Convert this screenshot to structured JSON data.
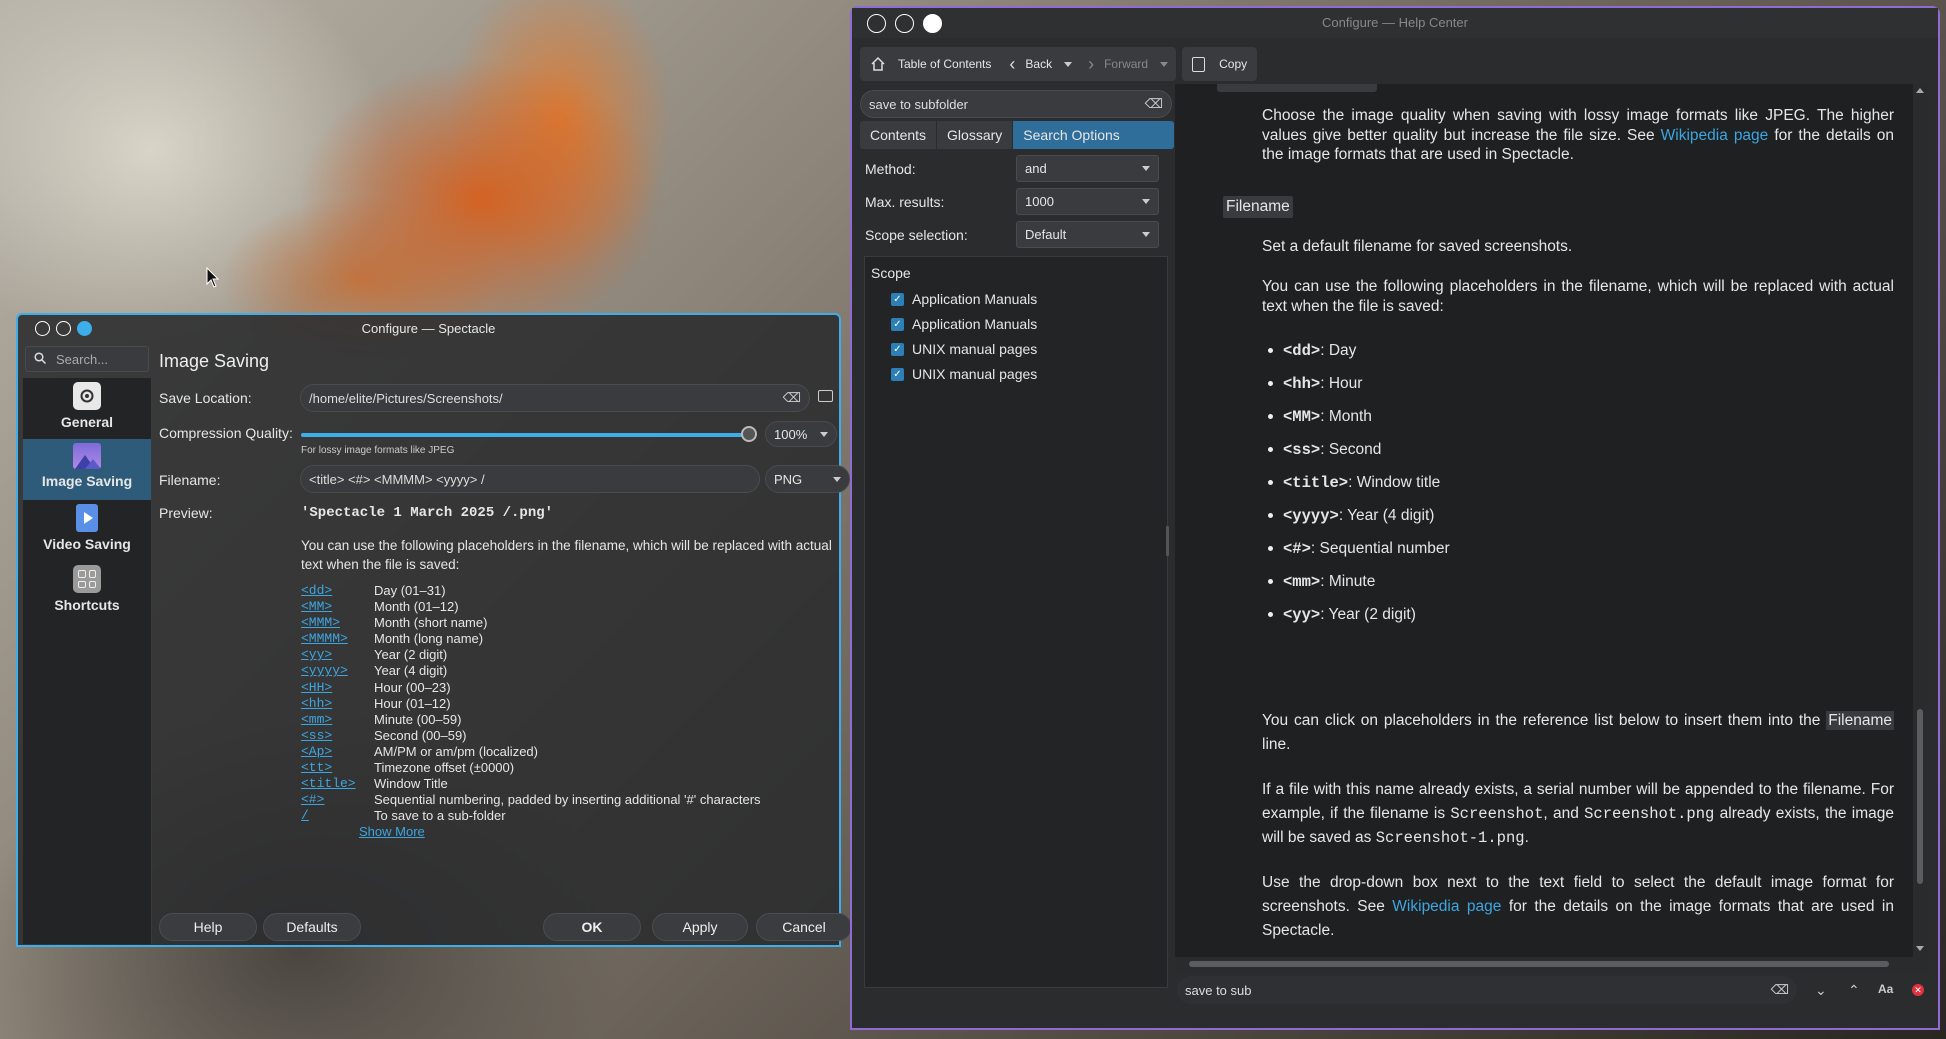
{
  "spectacle": {
    "title": "Configure — Spectacle",
    "search_placeholder": "Search...",
    "sidebar": [
      {
        "label": "General",
        "icon": "camera-icon"
      },
      {
        "label": "Image Saving",
        "icon": "image-icon"
      },
      {
        "label": "Video Saving",
        "icon": "video-icon"
      },
      {
        "label": "Shortcuts",
        "icon": "shortcuts-icon"
      }
    ],
    "page_title": "Image Saving",
    "save_location_label": "Save Location:",
    "save_location_value": "/home/elite/Pictures/Screenshots/",
    "compression_label": "Compression Quality:",
    "compression_value": "100%",
    "compression_level": 100,
    "compression_hint": "For lossy image formats like JPEG",
    "filename_label": "Filename:",
    "filename_value": "<title> <#> <MMMM> <yyyy> /",
    "format_value": "PNG",
    "preview_label": "Preview:",
    "preview_value": "'Spectacle 1 March 2025 /.png'",
    "placeholder_intro": "You can use the following placeholders in the filename, which will be replaced with actual text when the file is saved:",
    "placeholders": [
      {
        "key": "<dd>",
        "desc": "Day (01–31)"
      },
      {
        "key": "<MM>",
        "desc": "Month (01–12)"
      },
      {
        "key": "<MMM>",
        "desc": "Month (short name)"
      },
      {
        "key": "<MMMM>",
        "desc": "Month (long name)"
      },
      {
        "key": "<yy>",
        "desc": "Year (2 digit)"
      },
      {
        "key": "<yyyy>",
        "desc": "Year (4 digit)"
      },
      {
        "key": "<HH>",
        "desc": "Hour (00–23)"
      },
      {
        "key": "<hh>",
        "desc": "Hour (01–12)"
      },
      {
        "key": "<mm>",
        "desc": "Minute (00–59)"
      },
      {
        "key": "<ss>",
        "desc": "Second (00–59)"
      },
      {
        "key": "<Ap>",
        "desc": "AM/PM or am/pm (localized)"
      },
      {
        "key": "<tt>",
        "desc": "Timezone offset (±0000)"
      },
      {
        "key": "<title>",
        "desc": "Window Title"
      },
      {
        "key": "<#>",
        "desc": "Sequential numbering, padded by inserting additional '#' characters"
      },
      {
        "key": "/",
        "desc": "To save to a sub-folder"
      }
    ],
    "show_more": "Show More",
    "buttons": {
      "help": "Help",
      "defaults": "Defaults",
      "ok": "OK",
      "apply": "Apply",
      "cancel": "Cancel"
    }
  },
  "helpcenter": {
    "title": "Configure — Help Center",
    "toolbar": {
      "toc": "Table of Contents",
      "back": "Back",
      "forward": "Forward",
      "copy": "Copy"
    },
    "search_value": "save to subfolder",
    "tabs": [
      "Contents",
      "Glossary",
      "Search Options"
    ],
    "method_label": "Method:",
    "method_value": "and",
    "max_label": "Max. results:",
    "max_value": "1000",
    "scope_sel_label": "Scope selection:",
    "scope_sel_value": "Default",
    "scope_header": "Scope",
    "scope_items": [
      "Application Manuals",
      "Application Manuals",
      "UNIX manual pages",
      "UNIX manual pages"
    ],
    "content": {
      "p1": "Choose the image quality when saving with lossy image formats like JPEG. The higher values give better quality but increase the file size. See",
      "p1_link": "Wikipedia page",
      "p1_end": "for the details on the image formats that are used in Spectacle.",
      "filename_heading": "Filename",
      "p2": "Set a default filename for saved screenshots.",
      "p3": "You can use the following placeholders in the filename, which will be replaced with actual text when the file is saved:",
      "bullets": [
        {
          "code": "<dd>",
          "text": ": Day"
        },
        {
          "code": "<hh>",
          "text": ": Hour"
        },
        {
          "code": "<MM>",
          "text": ": Month"
        },
        {
          "code": "<ss>",
          "text": ": Second"
        },
        {
          "code": "<title>",
          "text": ": Window title"
        },
        {
          "code": "<yyyy>",
          "text": ": Year (4 digit)"
        },
        {
          "code": "<#>",
          "text": ": Sequential number"
        },
        {
          "code": "<mm>",
          "text": ": Minute"
        },
        {
          "code": "<yy>",
          "text": ": Year (2 digit)"
        }
      ],
      "p4a": "You can click on placeholders in the reference list below to insert them into the",
      "p4_hl": "Filename",
      "p4b": "line.",
      "p5a": "If a file with this name already exists, a serial number will be appended to the filename. For example, if the filename is",
      "p5_c1": "Screenshot",
      "p5b": ", and",
      "p5_c2": "Screenshot.png",
      "p5c": "already exists, the image will be saved as",
      "p5_c3": "Screenshot-1.png",
      "p5d": ".",
      "p6a": "Use the drop-down box next to the text field to select the default image format for screenshots. See",
      "p6_link": "Wikipedia page",
      "p6b": "for the details on the image formats that are used in Spectacle."
    },
    "find_value": "save to sub"
  }
}
